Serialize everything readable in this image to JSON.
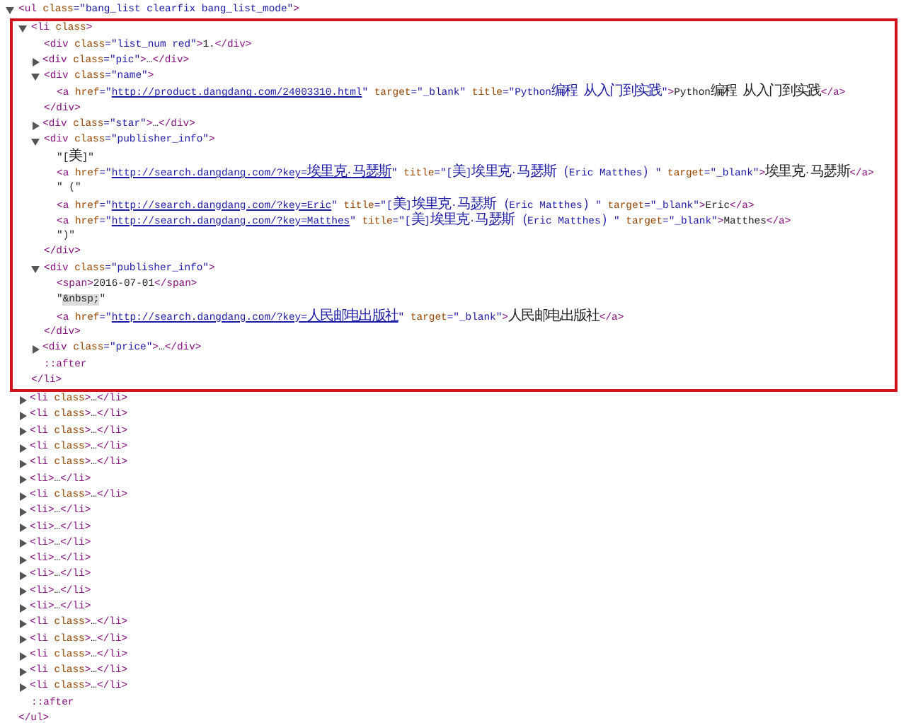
{
  "dom_tree": {
    "line": [
      {
        "kind": "tag",
        "text": "<ul"
      },
      {
        "kind": "attr",
        "text": " class"
      },
      {
        "kind": "value",
        "text": "=\"bang_list clearfix bang_list_mode\""
      },
      {
        "kind": "tag",
        "text": ">"
      }
    ],
    "expanded": true,
    "closing": [
      {
        "kind": "tag",
        "text": "</ul>"
      }
    ],
    "children": [
      {
        "outlined": true,
        "expanded": true,
        "line": [
          {
            "kind": "tag",
            "text": "<li"
          },
          {
            "kind": "attr",
            "text": " class"
          },
          {
            "kind": "tag",
            "text": ">"
          }
        ],
        "closing": [
          {
            "kind": "tag",
            "text": "</li>"
          }
        ],
        "children": [
          {
            "line": [
              {
                "kind": "tag",
                "text": "<div"
              },
              {
                "kind": "attr",
                "text": " class"
              },
              {
                "kind": "value",
                "text": "=\"list_num red\""
              },
              {
                "kind": "tag",
                "text": ">"
              },
              {
                "kind": "text",
                "text": "1."
              },
              {
                "kind": "tag",
                "text": "</div>"
              }
            ]
          },
          {
            "expanded": false,
            "line": [
              {
                "kind": "tag",
                "text": "<div"
              },
              {
                "kind": "attr",
                "text": " class"
              },
              {
                "kind": "value",
                "text": "=\"pic\""
              },
              {
                "kind": "tag",
                "text": ">"
              },
              {
                "kind": "text",
                "text": "…"
              },
              {
                "kind": "tag",
                "text": "</div>"
              }
            ]
          },
          {
            "expanded": true,
            "line": [
              {
                "kind": "tag",
                "text": "<div"
              },
              {
                "kind": "attr",
                "text": " class"
              },
              {
                "kind": "value",
                "text": "=\"name\""
              },
              {
                "kind": "tag",
                "text": ">"
              }
            ],
            "closing": [
              {
                "kind": "tag",
                "text": "</div>"
              }
            ],
            "children": [
              {
                "line": [
                  {
                    "kind": "tag",
                    "text": "<a"
                  },
                  {
                    "kind": "attr",
                    "text": " href"
                  },
                  {
                    "kind": "value",
                    "text": "=\""
                  },
                  {
                    "kind": "url",
                    "text": "http://product.dangdang.com/24003310.html"
                  },
                  {
                    "kind": "value",
                    "text": "\""
                  },
                  {
                    "kind": "attr",
                    "text": " target"
                  },
                  {
                    "kind": "value",
                    "text": "=\"_blank\""
                  },
                  {
                    "kind": "attr",
                    "text": " title"
                  },
                  {
                    "kind": "value",
                    "text": "=\"Python编程 从入门到实践\""
                  },
                  {
                    "kind": "tag",
                    "text": ">"
                  },
                  {
                    "kind": "text",
                    "text": "Python编程 从入门到实践"
                  },
                  {
                    "kind": "tag",
                    "text": "</a>"
                  }
                ]
              }
            ]
          },
          {
            "expanded": false,
            "line": [
              {
                "kind": "tag",
                "text": "<div"
              },
              {
                "kind": "attr",
                "text": " class"
              },
              {
                "kind": "value",
                "text": "=\"star\""
              },
              {
                "kind": "tag",
                "text": ">"
              },
              {
                "kind": "text",
                "text": "…"
              },
              {
                "kind": "tag",
                "text": "</div>"
              }
            ]
          },
          {
            "expanded": true,
            "line": [
              {
                "kind": "tag",
                "text": "<div"
              },
              {
                "kind": "attr",
                "text": " class"
              },
              {
                "kind": "value",
                "text": "=\"publisher_info\""
              },
              {
                "kind": "tag",
                "text": ">"
              }
            ],
            "closing": [
              {
                "kind": "tag",
                "text": "</div>"
              }
            ],
            "children": [
              {
                "line": [
                  {
                    "kind": "text",
                    "text": "\"[美]\""
                  }
                ]
              },
              {
                "line": [
                  {
                    "kind": "tag",
                    "text": "<a"
                  },
                  {
                    "kind": "attr",
                    "text": " href"
                  },
                  {
                    "kind": "value",
                    "text": "=\""
                  },
                  {
                    "kind": "url",
                    "text": "http://search.dangdang.com/?key=埃里克·马瑟斯"
                  },
                  {
                    "kind": "value",
                    "text": "\""
                  },
                  {
                    "kind": "attr",
                    "text": " title"
                  },
                  {
                    "kind": "value",
                    "text": "=\"[美]埃里克·马瑟斯（Eric Matthes）\""
                  },
                  {
                    "kind": "attr",
                    "text": " target"
                  },
                  {
                    "kind": "value",
                    "text": "=\"_blank\""
                  },
                  {
                    "kind": "tag",
                    "text": ">"
                  },
                  {
                    "kind": "text",
                    "text": "埃里克·马瑟斯"
                  },
                  {
                    "kind": "tag",
                    "text": "</a>"
                  }
                ]
              },
              {
                "line": [
                  {
                    "kind": "text",
                    "text": "\" (\""
                  }
                ]
              },
              {
                "line": [
                  {
                    "kind": "tag",
                    "text": "<a"
                  },
                  {
                    "kind": "attr",
                    "text": " href"
                  },
                  {
                    "kind": "value",
                    "text": "=\""
                  },
                  {
                    "kind": "url",
                    "text": "http://search.dangdang.com/?key=Eric"
                  },
                  {
                    "kind": "value",
                    "text": "\""
                  },
                  {
                    "kind": "attr",
                    "text": " title"
                  },
                  {
                    "kind": "value",
                    "text": "=\"[美]埃里克·马瑟斯（Eric Matthes）\""
                  },
                  {
                    "kind": "attr",
                    "text": " target"
                  },
                  {
                    "kind": "value",
                    "text": "=\"_blank\""
                  },
                  {
                    "kind": "tag",
                    "text": ">"
                  },
                  {
                    "kind": "text",
                    "text": "Eric"
                  },
                  {
                    "kind": "tag",
                    "text": "</a>"
                  }
                ]
              },
              {
                "line": [
                  {
                    "kind": "tag",
                    "text": "<a"
                  },
                  {
                    "kind": "attr",
                    "text": " href"
                  },
                  {
                    "kind": "value",
                    "text": "=\""
                  },
                  {
                    "kind": "url",
                    "text": "http://search.dangdang.com/?key=Matthes"
                  },
                  {
                    "kind": "value",
                    "text": "\""
                  },
                  {
                    "kind": "attr",
                    "text": " title"
                  },
                  {
                    "kind": "value",
                    "text": "=\"[美]埃里克·马瑟斯（Eric Matthes）\""
                  },
                  {
                    "kind": "attr",
                    "text": " target"
                  },
                  {
                    "kind": "value",
                    "text": "=\"_blank\""
                  },
                  {
                    "kind": "tag",
                    "text": ">"
                  },
                  {
                    "kind": "text",
                    "text": "Matthes"
                  },
                  {
                    "kind": "tag",
                    "text": "</a>"
                  }
                ]
              },
              {
                "line": [
                  {
                    "kind": "text",
                    "text": "\")\""
                  }
                ]
              }
            ]
          },
          {
            "expanded": true,
            "line": [
              {
                "kind": "tag",
                "text": "<div"
              },
              {
                "kind": "attr",
                "text": " class"
              },
              {
                "kind": "value",
                "text": "=\"publisher_info\""
              },
              {
                "kind": "tag",
                "text": ">"
              }
            ],
            "closing": [
              {
                "kind": "tag",
                "text": "</div>"
              }
            ],
            "children": [
              {
                "line": [
                  {
                    "kind": "tag",
                    "text": "<span>"
                  },
                  {
                    "kind": "text",
                    "text": "2016-07-01"
                  },
                  {
                    "kind": "tag",
                    "text": "</span>"
                  }
                ]
              },
              {
                "line": [
                  {
                    "kind": "text",
                    "text": "\""
                  },
                  {
                    "kind": "entity",
                    "text": "&nbsp;"
                  },
                  {
                    "kind": "text",
                    "text": "\""
                  }
                ]
              },
              {
                "line": [
                  {
                    "kind": "tag",
                    "text": "<a"
                  },
                  {
                    "kind": "attr",
                    "text": " href"
                  },
                  {
                    "kind": "value",
                    "text": "=\""
                  },
                  {
                    "kind": "url",
                    "text": "http://search.dangdang.com/?key=人民邮电出版社"
                  },
                  {
                    "kind": "value",
                    "text": "\""
                  },
                  {
                    "kind": "attr",
                    "text": " target"
                  },
                  {
                    "kind": "value",
                    "text": "=\"_blank\""
                  },
                  {
                    "kind": "tag",
                    "text": ">"
                  },
                  {
                    "kind": "text",
                    "text": "人民邮电出版社"
                  },
                  {
                    "kind": "tag",
                    "text": "</a>"
                  }
                ]
              }
            ]
          },
          {
            "expanded": false,
            "line": [
              {
                "kind": "tag",
                "text": "<div"
              },
              {
                "kind": "attr",
                "text": " class"
              },
              {
                "kind": "value",
                "text": "=\"price\""
              },
              {
                "kind": "tag",
                "text": ">"
              },
              {
                "kind": "text",
                "text": "…"
              },
              {
                "kind": "tag",
                "text": "</div>"
              }
            ]
          },
          {
            "line": [
              {
                "kind": "pseudo",
                "text": "::after"
              }
            ]
          }
        ]
      },
      {
        "outlined": false,
        "expanded": false,
        "line": [
          {
            "kind": "tag",
            "text": "<li"
          },
          {
            "kind": "attr",
            "text": " class"
          },
          {
            "kind": "tag",
            "text": ">"
          },
          {
            "kind": "text",
            "text": "…"
          },
          {
            "kind": "tag",
            "text": "</li>"
          }
        ]
      },
      {
        "outlined": false,
        "expanded": false,
        "line": [
          {
            "kind": "tag",
            "text": "<li"
          },
          {
            "kind": "attr",
            "text": " class"
          },
          {
            "kind": "tag",
            "text": ">"
          },
          {
            "kind": "text",
            "text": "…"
          },
          {
            "kind": "tag",
            "text": "</li>"
          }
        ]
      },
      {
        "outlined": false,
        "expanded": false,
        "line": [
          {
            "kind": "tag",
            "text": "<li"
          },
          {
            "kind": "attr",
            "text": " class"
          },
          {
            "kind": "tag",
            "text": ">"
          },
          {
            "kind": "text",
            "text": "…"
          },
          {
            "kind": "tag",
            "text": "</li>"
          }
        ]
      },
      {
        "outlined": false,
        "expanded": false,
        "line": [
          {
            "kind": "tag",
            "text": "<li"
          },
          {
            "kind": "attr",
            "text": " class"
          },
          {
            "kind": "tag",
            "text": ">"
          },
          {
            "kind": "text",
            "text": "…"
          },
          {
            "kind": "tag",
            "text": "</li>"
          }
        ]
      },
      {
        "outlined": false,
        "expanded": false,
        "line": [
          {
            "kind": "tag",
            "text": "<li"
          },
          {
            "kind": "attr",
            "text": " class"
          },
          {
            "kind": "tag",
            "text": ">"
          },
          {
            "kind": "text",
            "text": "…"
          },
          {
            "kind": "tag",
            "text": "</li>"
          }
        ]
      },
      {
        "outlined": false,
        "expanded": false,
        "line": [
          {
            "kind": "tag",
            "text": "<li>"
          },
          {
            "kind": "text",
            "text": "…"
          },
          {
            "kind": "tag",
            "text": "</li>"
          }
        ]
      },
      {
        "outlined": false,
        "expanded": false,
        "line": [
          {
            "kind": "tag",
            "text": "<li"
          },
          {
            "kind": "attr",
            "text": " class"
          },
          {
            "kind": "tag",
            "text": ">"
          },
          {
            "kind": "text",
            "text": "…"
          },
          {
            "kind": "tag",
            "text": "</li>"
          }
        ]
      },
      {
        "outlined": false,
        "expanded": false,
        "line": [
          {
            "kind": "tag",
            "text": "<li>"
          },
          {
            "kind": "text",
            "text": "…"
          },
          {
            "kind": "tag",
            "text": "</li>"
          }
        ]
      },
      {
        "outlined": false,
        "expanded": false,
        "line": [
          {
            "kind": "tag",
            "text": "<li>"
          },
          {
            "kind": "text",
            "text": "…"
          },
          {
            "kind": "tag",
            "text": "</li>"
          }
        ]
      },
      {
        "outlined": false,
        "expanded": false,
        "line": [
          {
            "kind": "tag",
            "text": "<li>"
          },
          {
            "kind": "text",
            "text": "…"
          },
          {
            "kind": "tag",
            "text": "</li>"
          }
        ]
      },
      {
        "outlined": false,
        "expanded": false,
        "line": [
          {
            "kind": "tag",
            "text": "<li>"
          },
          {
            "kind": "text",
            "text": "…"
          },
          {
            "kind": "tag",
            "text": "</li>"
          }
        ]
      },
      {
        "outlined": false,
        "expanded": false,
        "line": [
          {
            "kind": "tag",
            "text": "<li>"
          },
          {
            "kind": "text",
            "text": "…"
          },
          {
            "kind": "tag",
            "text": "</li>"
          }
        ]
      },
      {
        "outlined": false,
        "expanded": false,
        "line": [
          {
            "kind": "tag",
            "text": "<li>"
          },
          {
            "kind": "text",
            "text": "…"
          },
          {
            "kind": "tag",
            "text": "</li>"
          }
        ]
      },
      {
        "outlined": false,
        "expanded": false,
        "line": [
          {
            "kind": "tag",
            "text": "<li>"
          },
          {
            "kind": "text",
            "text": "…"
          },
          {
            "kind": "tag",
            "text": "</li>"
          }
        ]
      },
      {
        "outlined": false,
        "expanded": false,
        "line": [
          {
            "kind": "tag",
            "text": "<li"
          },
          {
            "kind": "attr",
            "text": " class"
          },
          {
            "kind": "tag",
            "text": ">"
          },
          {
            "kind": "text",
            "text": "…"
          },
          {
            "kind": "tag",
            "text": "</li>"
          }
        ]
      },
      {
        "outlined": false,
        "expanded": false,
        "line": [
          {
            "kind": "tag",
            "text": "<li"
          },
          {
            "kind": "attr",
            "text": " class"
          },
          {
            "kind": "tag",
            "text": ">"
          },
          {
            "kind": "text",
            "text": "…"
          },
          {
            "kind": "tag",
            "text": "</li>"
          }
        ]
      },
      {
        "outlined": false,
        "expanded": false,
        "line": [
          {
            "kind": "tag",
            "text": "<li"
          },
          {
            "kind": "attr",
            "text": " class"
          },
          {
            "kind": "tag",
            "text": ">"
          },
          {
            "kind": "text",
            "text": "…"
          },
          {
            "kind": "tag",
            "text": "</li>"
          }
        ]
      },
      {
        "outlined": false,
        "expanded": false,
        "line": [
          {
            "kind": "tag",
            "text": "<li"
          },
          {
            "kind": "attr",
            "text": " class"
          },
          {
            "kind": "tag",
            "text": ">"
          },
          {
            "kind": "text",
            "text": "…"
          },
          {
            "kind": "tag",
            "text": "</li>"
          }
        ]
      },
      {
        "outlined": false,
        "expanded": false,
        "line": [
          {
            "kind": "tag",
            "text": "<li"
          },
          {
            "kind": "attr",
            "text": " class"
          },
          {
            "kind": "tag",
            "text": ">"
          },
          {
            "kind": "text",
            "text": "…"
          },
          {
            "kind": "tag",
            "text": "</li>"
          }
        ]
      },
      {
        "outlined": false,
        "line": [
          {
            "kind": "pseudo",
            "text": "::after"
          }
        ]
      }
    ]
  }
}
